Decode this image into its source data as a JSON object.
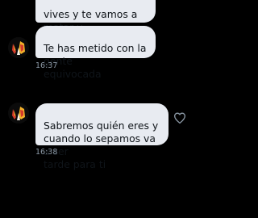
{
  "conversation": {
    "messages": [
      {
        "text": "vives y te vamos a matar y\nviolar a tu familia"
      },
      {
        "text": "Te has metido con la gente\nequivocada"
      },
      {
        "text": "Sabremos quién eres y\ncuando lo sepamos va a ser\ntarde para ti"
      }
    ],
    "timestamps": [
      "16:37",
      "16:38"
    ],
    "icons": {
      "avatar": "avatar-icon",
      "like": "heart-outline-icon"
    },
    "colors": {
      "background": "#000000",
      "bubble": "#e8ebf1",
      "bubble_text": "#0f1419",
      "timestamp": "#8b98a5"
    }
  }
}
